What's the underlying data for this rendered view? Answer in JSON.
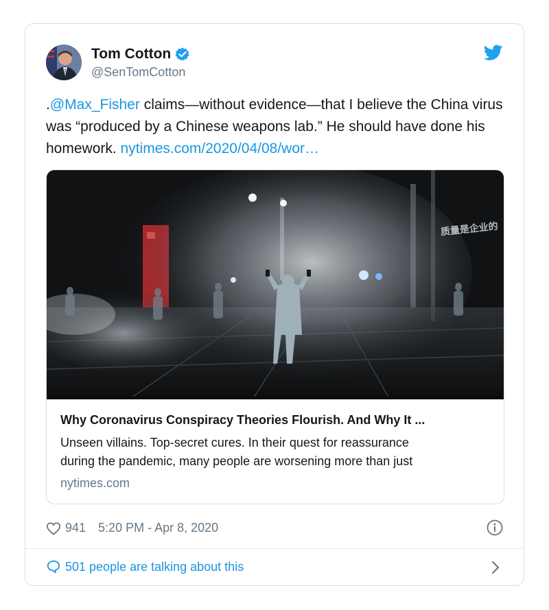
{
  "author": {
    "name": "Tom Cotton",
    "handle": "@SenTomCotton"
  },
  "tweet": {
    "mention": "@Max_Fisher",
    "text_prefix": ".",
    "text_main": " claims—without evidence—that I believe the China virus was “produced by a Chinese weapons lab.” He should have done his homework. ",
    "link": "nytimes.com/2020/04/08/wor…"
  },
  "preview": {
    "title": "Why Coronavirus Conspiracy Theories Flourish. And Why It ...",
    "description_line1": "Unseen villains. Top-secret cures. In their quest for reassurance",
    "description_line2": "during the pandemic, many people are worsening more than just",
    "domain": "nytimes.com",
    "image_sign_text": "质量是企业的"
  },
  "footer": {
    "likes": "941",
    "timestamp": "5:20 PM - Apr 8, 2020",
    "talking": "501 people are talking about this"
  },
  "colors": {
    "accent": "#1b95e0",
    "muted": "#657786",
    "border": "#d9dee2"
  },
  "icons": [
    "verified-badge-icon",
    "twitter-bird-icon",
    "heart-icon",
    "info-icon",
    "speech-bubble-icon",
    "chevron-right-icon"
  ]
}
